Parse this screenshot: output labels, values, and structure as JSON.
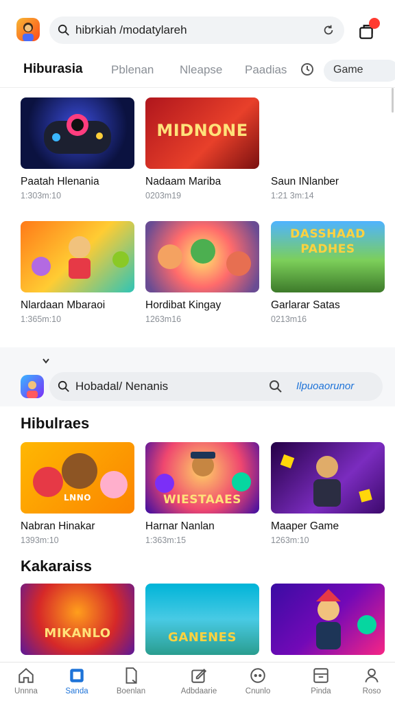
{
  "header": {
    "search_text": "hibrkiah /modatylareh",
    "search_icon": "search-icon",
    "refresh_icon": "refresh-icon",
    "notification_icon": "notification-icon"
  },
  "tabs": [
    {
      "label": "Hiburasia",
      "active": true
    },
    {
      "label": "Pblenan"
    },
    {
      "label": "Nleapse"
    },
    {
      "label": "Paadias"
    },
    {
      "label": "Game"
    }
  ],
  "section1": {
    "games": [
      {
        "title": "Paatah Hlenania",
        "meta": "1:303m:10",
        "art": ""
      },
      {
        "title": "Nadaam Mariba",
        "meta": "0203m19",
        "art": "MIDNONE"
      },
      {
        "title": "Saun INlanber",
        "meta": "1:21 3m:14",
        "art": ""
      },
      {
        "title": "Nlardaan Mbaraoi",
        "meta": "1:365m:10",
        "art": ""
      },
      {
        "title": "Hordibat Kingay",
        "meta": "1263m16",
        "art": ""
      },
      {
        "title": "Garlarar Satas",
        "meta": "0213m16",
        "art": "DASSHAAD PADHES"
      }
    ]
  },
  "section2": {
    "search_text": "Hobadal/ Nenanis",
    "link_text": "Ilpuoaorunor",
    "title": "Hibulraes",
    "games": [
      {
        "title": "Nabran Hinakar",
        "meta": "1393m:10",
        "art": "LNNO"
      },
      {
        "title": "Harnar Nanlan",
        "meta": "1:363m:15",
        "art": "WIESTAAES"
      },
      {
        "title": "Maaper Game",
        "meta": "1263m:10",
        "art": ""
      }
    ]
  },
  "section3": {
    "title": "Kakaraiss",
    "games": [
      {
        "art": "MIKANLO"
      },
      {
        "art": "GANENES"
      },
      {
        "art": ""
      }
    ]
  },
  "bottom_nav": [
    {
      "label": "Unnna",
      "icon": "home-icon"
    },
    {
      "label": "Sanda",
      "icon": "square-icon",
      "active": true
    },
    {
      "label": "Boenlan",
      "icon": "document-icon"
    },
    {
      "label": "Adbdaarie",
      "icon": "edit-icon"
    },
    {
      "label": "Cnunlo",
      "icon": "controller-icon"
    },
    {
      "label": "Pinda",
      "icon": "grid-icon"
    },
    {
      "label": "Roso",
      "icon": "profile-icon"
    }
  ],
  "colors": {
    "accent": "#1e73d8",
    "badge": "#ff3b30",
    "muted": "#8a8f96"
  }
}
